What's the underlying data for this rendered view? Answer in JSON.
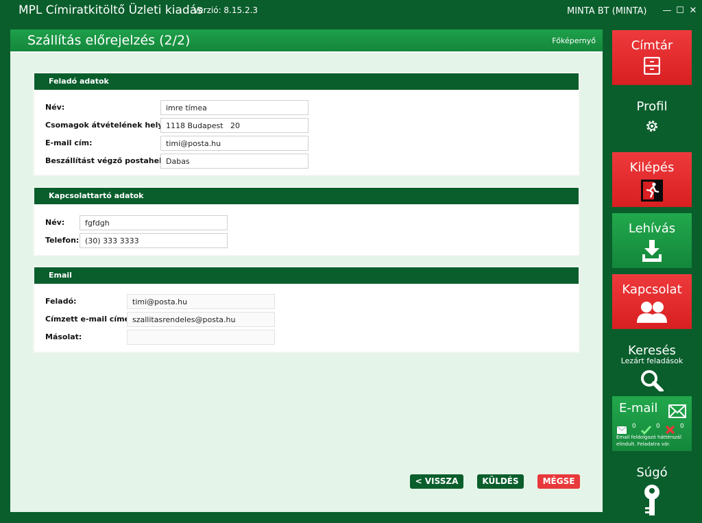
{
  "window": {
    "app_title": "MPL Címiratkitöltő Üzleti kiadás",
    "version": "Verzió: 8.15.2.3",
    "company": "MINTA BT (MINTA)",
    "minimize": "—",
    "maximize": "☐",
    "close": "✕"
  },
  "page": {
    "title": "Szállítás előrejelzés (2/2)",
    "home_link": "Főképernyő"
  },
  "sender": {
    "heading": "Feladó adatok",
    "fields": [
      {
        "label": "Név:",
        "value": "imre tímea"
      },
      {
        "label": "Csomagok átvételének helye:",
        "value": "1118 Budapest   20"
      },
      {
        "label": "E-mail cím:",
        "value": "timi@posta.hu"
      },
      {
        "label": "Beszállítást végző postahely:",
        "value": "Dabas"
      }
    ]
  },
  "contact": {
    "heading": "Kapcsolattartó adatok",
    "fields": [
      {
        "label": "Név:",
        "value": "fgfdgh"
      },
      {
        "label": "Telefon:",
        "value": "(30) 333 3333"
      }
    ]
  },
  "email": {
    "heading": "Email",
    "fields": [
      {
        "label": "Feladó:",
        "value": "timi@posta.hu"
      },
      {
        "label": "Címzett e-mail címe:",
        "value": "szallitasrendeles@posta.hu"
      },
      {
        "label": "Másolat:",
        "value": ""
      }
    ]
  },
  "buttons": {
    "back": "< VISSZA",
    "send": "KÜLDÉS",
    "cancel": "MÉGSE"
  },
  "sidebar": {
    "directory": "Címtár",
    "profile": "Profil",
    "logout": "Kilépés",
    "download": "Lehívás",
    "contact": "Kapcsolat",
    "search": "Keresés",
    "search_sub": "Lezárt feladások",
    "email": "E-mail",
    "email_counts": [
      "0",
      "0",
      "0"
    ],
    "email_status": "Email feldolgozó háttérszál elindult. Feladatra vár.",
    "help": "Súgó"
  },
  "colors": {
    "dark_green": "#0a5e2c",
    "light_green": "#1ea04a",
    "red": "#e8393b",
    "panel_bg": "#e5f4e8"
  }
}
